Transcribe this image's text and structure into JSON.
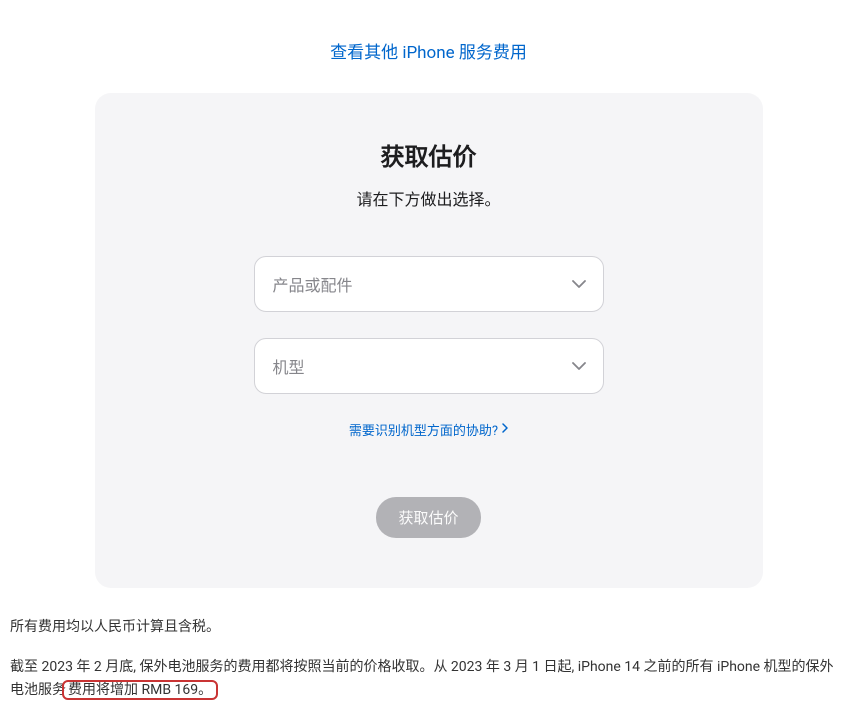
{
  "topLink": {
    "label": "查看其他 iPhone 服务费用"
  },
  "card": {
    "title": "获取估价",
    "subtitle": "请在下方做出选择。",
    "select1": {
      "placeholder": "产品或配件"
    },
    "select2": {
      "placeholder": "机型"
    },
    "helpLink": {
      "label": "需要识别机型方面的协助?"
    },
    "submitButton": {
      "label": "获取估价"
    }
  },
  "footer": {
    "line1": "所有费用均以人民币计算且含税。",
    "line2_part1": "截至 2023 年 2 月底, 保外电池服务的费用都将按照当前的价格收取。从 2023 年 3 月 1 日起, iPhone 14 之前的所有 iPhone 机型的保外电池服务",
    "line2_part2": "费用将增加 RMB 169。"
  }
}
